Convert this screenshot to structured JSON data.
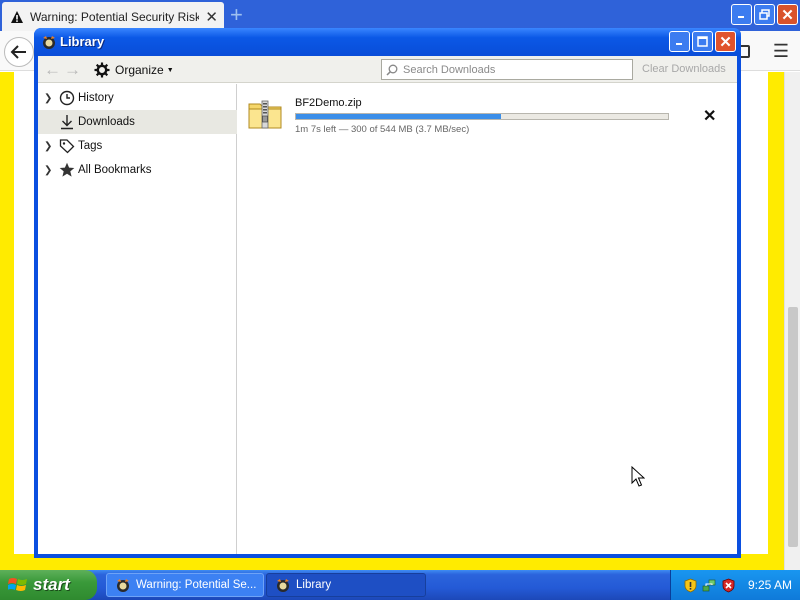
{
  "browser": {
    "tab_title": "Warning: Potential Security Risk A",
    "new_tab_symbol": "+"
  },
  "library": {
    "window_title": "Library",
    "toolbar": {
      "organize_label": "Organize",
      "search_placeholder": "Search Downloads",
      "clear_label": "Clear Downloads"
    },
    "sidebar": [
      {
        "label": "History",
        "icon": "clock-icon",
        "expandable": true,
        "selected": false
      },
      {
        "label": "Downloads",
        "icon": "download-arrow-icon",
        "expandable": false,
        "selected": true
      },
      {
        "label": "Tags",
        "icon": "tag-icon",
        "expandable": true,
        "selected": false
      },
      {
        "label": "All Bookmarks",
        "icon": "star-icon",
        "expandable": true,
        "selected": false
      }
    ],
    "download": {
      "filename": "BF2Demo.zip",
      "status": "1m 7s left — 300 of 544 MB (3.7 MB/sec)",
      "progress_percent": 55,
      "icon": "zip-folder-icon"
    }
  },
  "taskbar": {
    "start_label": "start",
    "tasks": [
      {
        "label": "Warning: Potential Se...",
        "icon": "firefox-icon"
      },
      {
        "label": "Library",
        "icon": "firefox-icon"
      }
    ],
    "clock": "9:25 AM"
  },
  "colors": {
    "xp_title_blue": "#0a4fe0",
    "page_yellow": "#ffeb00",
    "progress_blue": "#3b8ee8",
    "start_green": "#3a9a3a"
  }
}
